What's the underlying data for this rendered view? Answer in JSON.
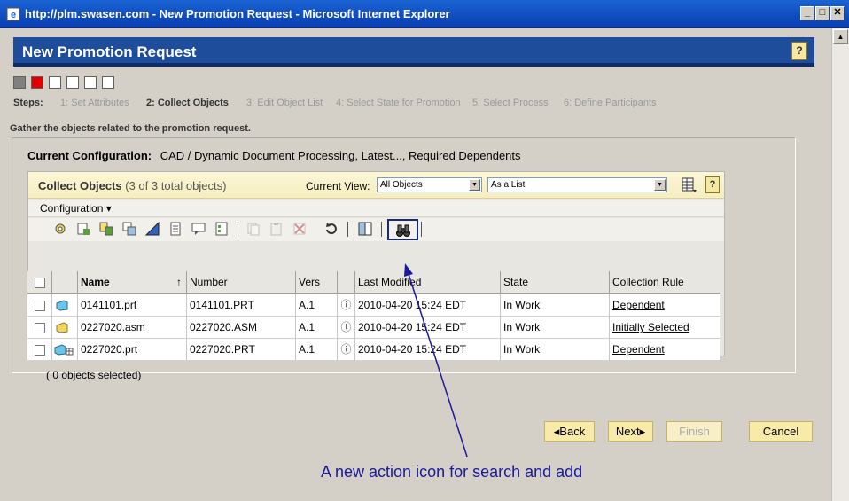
{
  "window": {
    "title": "http://plm.swasen.com - New Promotion Request - Microsoft Internet Explorer",
    "minimize": "_",
    "maximize": "□",
    "close": "✕"
  },
  "page": {
    "title": "New Promotion Request",
    "help": "?"
  },
  "steps": {
    "label": "Steps:",
    "items": [
      "1: Set Attributes",
      "2: Collect Objects",
      "3: Edit Object List",
      "4: Select State for Promotion",
      "5: Select Process",
      "6: Define Participants"
    ],
    "current_index": 1,
    "boxes": [
      "done",
      "current",
      "todo",
      "todo",
      "todo",
      "todo"
    ],
    "colors": {
      "done": "#808080",
      "current": "#e00000",
      "todo": "#ffffff"
    }
  },
  "instructions": "Gather the objects related to the promotion request.",
  "config": {
    "label": "Current Configuration:",
    "value": "CAD / Dynamic Document Processing, Latest..., Required Dependents"
  },
  "collect": {
    "title": "Collect Objects",
    "count": "(3 of 3 total objects)",
    "current_view_label": "Current View:",
    "view_value": "All Objects",
    "display_value": "As a List",
    "help": "?",
    "configuration_menu": "Configuration ▾"
  },
  "table": {
    "headers": [
      "",
      "",
      "Name",
      "Number",
      "Vers",
      "",
      "Last Modified",
      "State",
      "Collection Rule"
    ],
    "sort_indicator": "↑",
    "rows": [
      {
        "name": "0141101.prt",
        "number": "0141101.PRT",
        "vers": "A.1",
        "info": "ⓘ",
        "modified": "2010-04-20 15:24 EDT",
        "state": "In Work",
        "rule": "Dependent"
      },
      {
        "name": "0227020.asm",
        "number": "0227020.ASM",
        "vers": "A.1",
        "info": "ⓘ",
        "modified": "2010-04-20 15:24 EDT",
        "state": "In Work",
        "rule": "Initially Selected"
      },
      {
        "name": "0227020.prt",
        "number": "0227020.PRT",
        "vers": "A.1",
        "info": "ⓘ",
        "modified": "2010-04-20 15:24 EDT",
        "state": "In Work",
        "rule": "Dependent"
      }
    ],
    "selected_count": "( 0 objects selected)"
  },
  "buttons": {
    "back": "◂Back",
    "next": "Next▸",
    "finish": "Finish",
    "cancel": "Cancel"
  },
  "callout": "A new action icon for search and add",
  "colors": {
    "header_bg": "#1e4d9b",
    "button_bg": "#f8eaa8",
    "callout": "#1a1a9a"
  }
}
